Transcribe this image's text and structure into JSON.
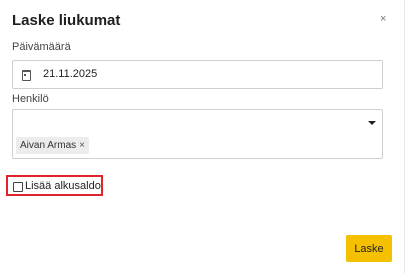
{
  "dialog": {
    "title": "Laske liukumat",
    "close_label": "×"
  },
  "date": {
    "label": "Päivämäärä",
    "value": "21.11.2025",
    "icon": "calendar-icon"
  },
  "person": {
    "label": "Henkilö",
    "selected": [
      {
        "name": "Aivan Armas",
        "remove_label": "×"
      }
    ],
    "icon": "dropdown-caret-icon"
  },
  "opening_balance": {
    "label": "Lisää alkusaldo",
    "checked": false
  },
  "actions": {
    "submit_label": "Laske",
    "accent_color": "#f5c000"
  },
  "highlight_color": "#e0242b"
}
